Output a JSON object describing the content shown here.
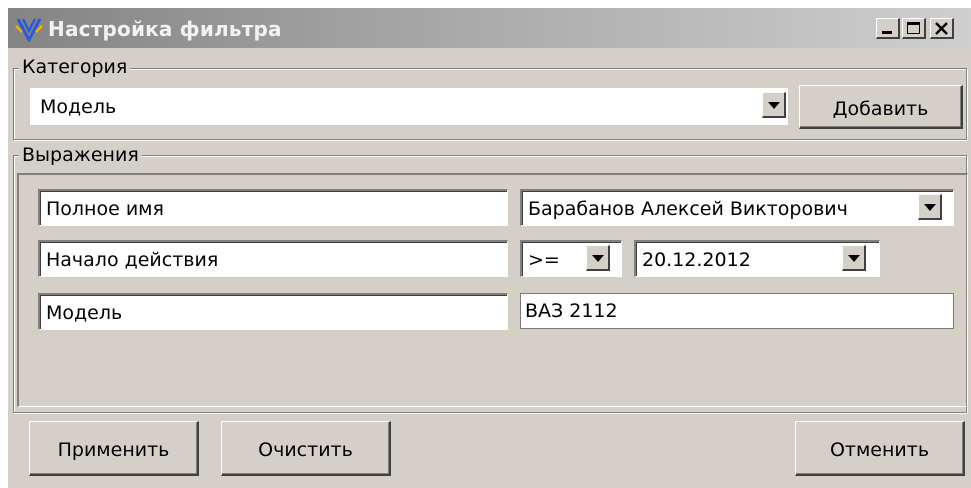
{
  "window": {
    "title": "Настройка фильтра",
    "controls": {
      "minimize": "_",
      "maximize": "□",
      "close": "X"
    }
  },
  "category": {
    "group_label": "Категория",
    "selected": "Модель",
    "add_button": "Добавить"
  },
  "expressions": {
    "group_label": "Выражения",
    "rows": [
      {
        "field": "Полное имя",
        "value": "Барабанов Алексей Викторович"
      },
      {
        "field": "Начало действия",
        "operator": ">=",
        "value": "20.12.2012"
      },
      {
        "field": "Модель",
        "value": "ВАЗ 2112"
      }
    ]
  },
  "footer": {
    "apply_button": "Применить",
    "clear_button": "Очистить",
    "cancel_button": "Отменить"
  },
  "colors": {
    "face": "#d4d0c8",
    "title_gradient_start": "#848484",
    "app_icon": "#2b59d8"
  },
  "icons": {
    "app": "antenna-logo-icon",
    "dropdown": "chevron-down-icon"
  }
}
